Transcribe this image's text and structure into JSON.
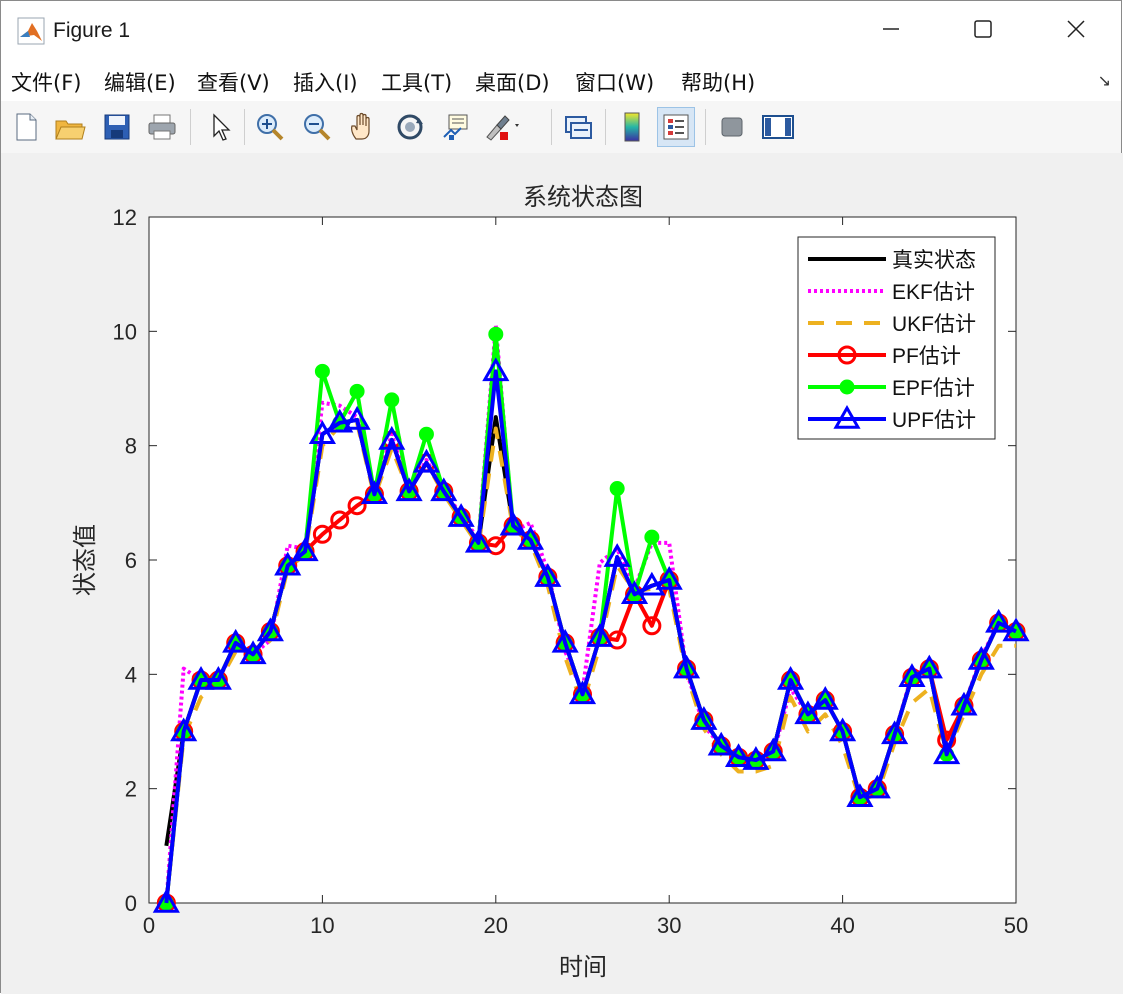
{
  "window": {
    "title": "Figure 1"
  },
  "menu": [
    "文件(F)",
    "编辑(E)",
    "查看(V)",
    "插入(I)",
    "工具(T)",
    "桌面(D)",
    "窗口(W)",
    "帮助(H)"
  ],
  "toolbar": [
    "new-figure-icon",
    "open-folder-icon",
    "save-icon",
    "print-icon",
    "pointer-icon",
    "zoom-in-icon",
    "zoom-out-icon",
    "pan-hand-icon",
    "rotate-3d-icon",
    "data-tips-icon",
    "brush-icon",
    "link-plot-icon",
    "colorbar-icon",
    "legend-icon",
    "hide-plot-tools-icon",
    "show-plot-tools-icon"
  ],
  "colors": {
    "true": "#000000",
    "ekf": "#ff00ff",
    "ukf": "#edb120",
    "pf": "#ff0000",
    "epf": "#00ff00",
    "upf": "#0000ff"
  },
  "chart_data": {
    "type": "line",
    "title": "系统状态图",
    "xlabel": "时间",
    "ylabel": "状态值",
    "xlim": [
      0,
      50
    ],
    "ylim": [
      0,
      12
    ],
    "xticks": [
      0,
      10,
      20,
      30,
      40,
      50
    ],
    "yticks": [
      0,
      2,
      4,
      6,
      8,
      10,
      12
    ],
    "legend_position": "top-right",
    "x": [
      1,
      2,
      3,
      4,
      5,
      6,
      7,
      8,
      9,
      10,
      11,
      12,
      13,
      14,
      15,
      16,
      17,
      18,
      19,
      20,
      21,
      22,
      23,
      24,
      25,
      26,
      27,
      28,
      29,
      30,
      31,
      32,
      33,
      34,
      35,
      36,
      37,
      38,
      39,
      40,
      41,
      42,
      43,
      44,
      45,
      46,
      47,
      48,
      49,
      50
    ],
    "series": [
      {
        "name": "真实状态",
        "key": "true",
        "style": "solid",
        "marker": "none",
        "values": [
          1.0,
          3.0,
          3.9,
          3.9,
          4.55,
          4.35,
          4.75,
          5.9,
          6.15,
          8.2,
          8.4,
          8.45,
          7.15,
          8.1,
          7.2,
          7.7,
          7.2,
          6.75,
          6.3,
          8.5,
          6.6,
          6.35,
          5.7,
          4.55,
          3.65,
          4.65,
          6.05,
          5.4,
          5.55,
          5.65,
          4.1,
          3.2,
          2.75,
          2.55,
          2.5,
          2.65,
          3.9,
          3.3,
          3.55,
          3.0,
          1.85,
          2.0,
          2.95,
          3.95,
          4.1,
          2.6,
          3.45,
          4.25,
          4.9,
          4.75
        ]
      },
      {
        "name": "EKF估计",
        "key": "ekf",
        "style": "dotted",
        "marker": "none",
        "values": [
          0.0,
          4.1,
          3.9,
          3.9,
          4.5,
          4.35,
          4.6,
          6.25,
          6.2,
          8.75,
          8.7,
          8.5,
          7.15,
          8.2,
          7.2,
          7.75,
          7.2,
          6.8,
          6.35,
          10.1,
          6.5,
          6.65,
          5.8,
          4.4,
          3.7,
          5.95,
          6.2,
          5.5,
          6.3,
          6.3,
          4.05,
          3.1,
          2.75,
          2.5,
          2.5,
          2.6,
          3.75,
          3.3,
          3.55,
          3.0,
          1.85,
          2.0,
          2.95,
          4.0,
          4.1,
          2.7,
          3.45,
          4.3,
          4.9,
          4.75
        ]
      },
      {
        "name": "UKF估计",
        "key": "ukf",
        "style": "dashed",
        "marker": "none",
        "values": [
          0.0,
          2.9,
          3.6,
          3.85,
          4.4,
          4.3,
          4.6,
          5.85,
          6.1,
          8.0,
          8.35,
          8.4,
          7.1,
          7.95,
          7.2,
          7.7,
          7.15,
          6.7,
          6.25,
          8.3,
          6.55,
          6.3,
          5.55,
          4.3,
          3.45,
          4.5,
          5.9,
          5.45,
          5.5,
          5.5,
          4.0,
          3.05,
          2.6,
          2.3,
          2.3,
          2.4,
          3.6,
          3.0,
          3.3,
          2.75,
          1.8,
          1.9,
          2.8,
          3.5,
          3.75,
          2.6,
          3.3,
          4.0,
          4.5,
          4.5
        ]
      },
      {
        "name": "PF估计",
        "key": "pf",
        "style": "solid",
        "marker": "circle",
        "values": [
          0.0,
          3.0,
          3.9,
          3.9,
          4.55,
          4.35,
          4.75,
          5.9,
          6.15,
          6.45,
          6.7,
          6.95,
          7.15,
          8.1,
          7.2,
          7.7,
          7.2,
          6.75,
          6.3,
          6.25,
          6.6,
          6.35,
          5.7,
          4.55,
          3.65,
          4.65,
          4.6,
          5.4,
          4.85,
          5.65,
          4.1,
          3.2,
          2.75,
          2.55,
          2.5,
          2.65,
          3.9,
          3.3,
          3.55,
          3.0,
          1.85,
          2.0,
          2.95,
          3.95,
          4.1,
          2.85,
          3.45,
          4.25,
          4.9,
          4.75
        ]
      },
      {
        "name": "EPF估计",
        "key": "epf",
        "style": "solid",
        "marker": "dot",
        "values": [
          0.0,
          3.0,
          3.9,
          3.9,
          4.55,
          4.35,
          4.75,
          5.9,
          6.15,
          9.3,
          8.4,
          8.95,
          7.15,
          8.8,
          7.2,
          8.2,
          7.2,
          6.75,
          6.3,
          9.95,
          6.6,
          6.35,
          5.7,
          4.55,
          3.65,
          4.65,
          7.25,
          5.4,
          6.4,
          5.65,
          4.1,
          3.2,
          2.75,
          2.55,
          2.5,
          2.65,
          3.9,
          3.3,
          3.55,
          3.0,
          1.85,
          2.0,
          2.95,
          3.95,
          4.1,
          2.6,
          3.45,
          4.25,
          4.9,
          4.75
        ]
      },
      {
        "name": "UPF估计",
        "key": "upf",
        "style": "solid",
        "marker": "triangle",
        "values": [
          0.0,
          3.0,
          3.9,
          3.9,
          4.55,
          4.35,
          4.75,
          5.9,
          6.15,
          8.2,
          8.4,
          8.45,
          7.15,
          8.1,
          7.2,
          7.7,
          7.2,
          6.75,
          6.3,
          9.3,
          6.6,
          6.35,
          5.7,
          4.55,
          3.65,
          4.65,
          6.05,
          5.4,
          5.55,
          5.65,
          4.1,
          3.2,
          2.75,
          2.55,
          2.5,
          2.65,
          3.9,
          3.3,
          3.55,
          3.0,
          1.85,
          2.0,
          2.95,
          3.95,
          4.1,
          2.6,
          3.45,
          4.25,
          4.9,
          4.75
        ]
      }
    ]
  }
}
